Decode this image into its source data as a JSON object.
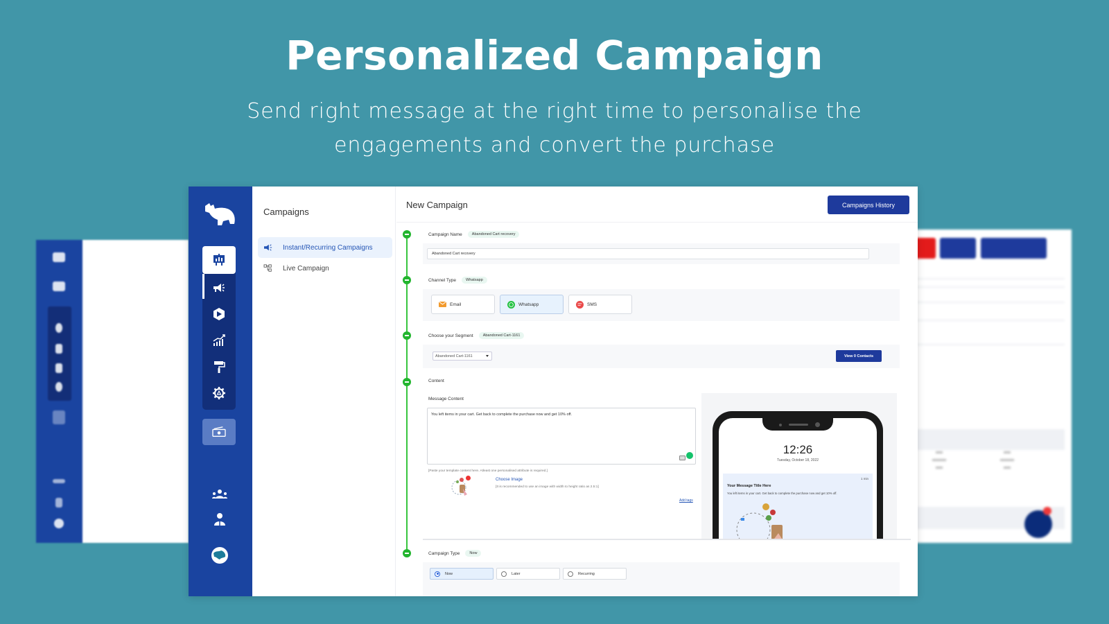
{
  "hero": {
    "title": "Personalized Campaign",
    "subtitle": "Send right message at the right time to personalise the engagements and convert the purchase"
  },
  "colors": {
    "background": "#4196a8",
    "rail": "#1a44a0",
    "primary_button": "#1e3a9c",
    "success": "#22b52e"
  },
  "rail": {
    "logo_icon": "hippo-logo-icon",
    "items": [
      {
        "icon": "presentation-chart-icon",
        "active": true
      },
      {
        "icon": "megaphone-icon",
        "active": false
      },
      {
        "icon": "play-hexagon-icon",
        "active": false
      },
      {
        "icon": "growth-chart-icon",
        "active": false
      },
      {
        "icon": "paint-roller-icon",
        "active": false
      },
      {
        "icon": "settings-gear-icon",
        "active": false
      }
    ],
    "extra_icon": "cash-icon",
    "bottom": [
      {
        "icon": "team-icon"
      },
      {
        "icon": "user-profile-icon"
      },
      {
        "icon": "globe-icon"
      }
    ]
  },
  "subnav": {
    "title": "Campaigns",
    "items": [
      {
        "label": "Instant/Recurring Campaigns",
        "icon": "megaphone-icon",
        "active": true
      },
      {
        "label": "Live Campaign",
        "icon": "flow-tree-icon",
        "active": false
      }
    ]
  },
  "main": {
    "title": "New Campaign",
    "history_button": "Campaigns History",
    "campaign_name": {
      "label": "Campaign Name",
      "chip": "Abandoned Cart recovery",
      "value": "Abandoned Cart recovery"
    },
    "channel_type": {
      "label": "Channel Type",
      "chip": "Whatsapp",
      "options": [
        {
          "label": "Email",
          "icon": "email-icon",
          "active": false
        },
        {
          "label": "Whatsapp",
          "icon": "whatsapp-icon",
          "active": true
        },
        {
          "label": "SMS",
          "icon": "sms-icon",
          "active": false
        }
      ]
    },
    "segment": {
      "label": "Choose your Segment",
      "chip": "Abandoned Cart-1161",
      "selected": "Abandoned Cart-1161",
      "contacts_button": "View 0 Contacts"
    },
    "content": {
      "label": "Content",
      "message_label": "Message Content",
      "message": "You left items in your cart. Get back to complete the purchase now and get 10% off.",
      "hint": "[Paste your template content here. Atleast one personalised attribute is required.]",
      "choose_image": "Choose Image",
      "image_hint": "[It is recommended to use an image with width to height ratio as 2.5:1]",
      "add_tags": "Add tags"
    },
    "preview": {
      "time": "12:26",
      "date": "Tuesday, October 18, 2022",
      "notif_time": "1 min",
      "notif_title": "Your Message Title Here",
      "notif_body": "You left items in your cart. Get back to complete the purchase now and get 10% off."
    },
    "campaign_type": {
      "label": "Campaign Type",
      "chip": "Now",
      "options": [
        {
          "label": "Now",
          "active": true
        },
        {
          "label": "Later",
          "active": false
        },
        {
          "label": "Recurring",
          "active": false
        }
      ]
    }
  }
}
